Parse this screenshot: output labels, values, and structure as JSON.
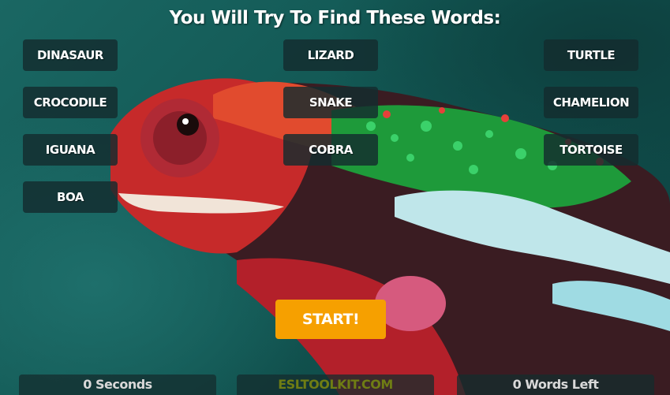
{
  "title": "You Will Try To Find These Words:",
  "words": {
    "dinasaur": "DINASAUR",
    "lizard": "LIZARD",
    "turtle": "TURTLE",
    "crocodile": "CROCODILE",
    "snake": "SNAKE",
    "chamelion": "CHAMELION",
    "iguana": "IGUANA",
    "cobra": "COBRA",
    "tortoise": "TORTOISE",
    "boa": "BOA"
  },
  "start_label": "START!",
  "footer": {
    "seconds": "0 Seconds",
    "brand": "ESLTOOLKIT.COM",
    "words_left": "0 Words Left"
  },
  "colors": {
    "accent": "#f6a000",
    "brand": "#6f7d14",
    "backdrop": "#125753"
  }
}
